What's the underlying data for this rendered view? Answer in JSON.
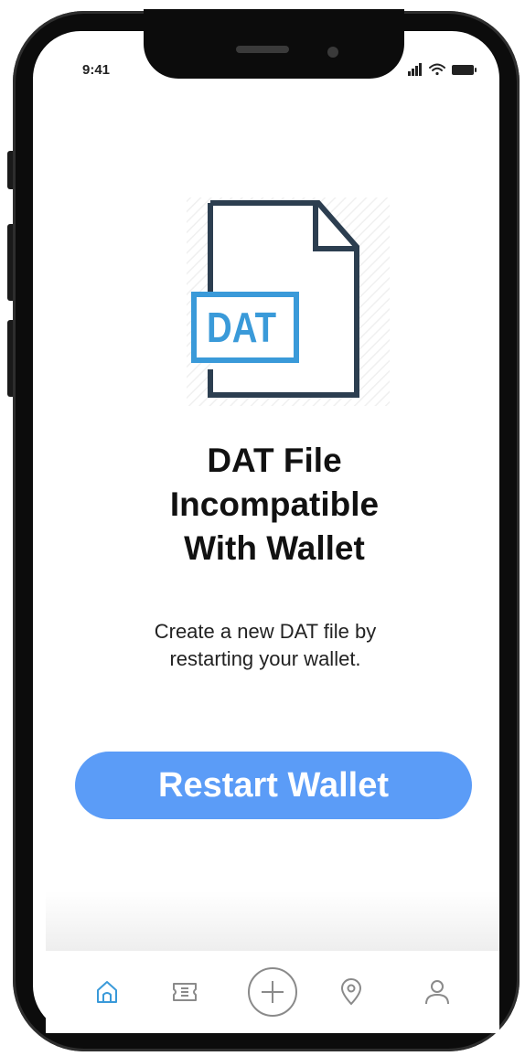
{
  "status_bar": {
    "time": "9:41",
    "icons": [
      "signal-icon",
      "wifi-icon",
      "battery-icon"
    ]
  },
  "illustration": {
    "file_badge_text": "DAT",
    "icon": "dat-file-icon",
    "colors": {
      "outline": "#2c3e50",
      "badge": "#3a9ad9"
    }
  },
  "content": {
    "title_lines": [
      "DAT File",
      "Incompatible",
      "With Wallet"
    ],
    "message_lines": [
      "Create a new DAT file by",
      "restarting your wallet."
    ]
  },
  "primary_action": {
    "label": "Restart Wallet",
    "color": "#5b9cf7"
  },
  "tab_bar": {
    "items": [
      {
        "icon": "home-icon",
        "active": true
      },
      {
        "icon": "ticket-icon",
        "active": false
      },
      {
        "icon": "add-icon",
        "active": false
      },
      {
        "icon": "location-pin-icon",
        "active": false
      },
      {
        "icon": "user-icon",
        "active": false
      }
    ],
    "active_color": "#3a9ad9",
    "inactive_color": "#8a8a8a"
  }
}
